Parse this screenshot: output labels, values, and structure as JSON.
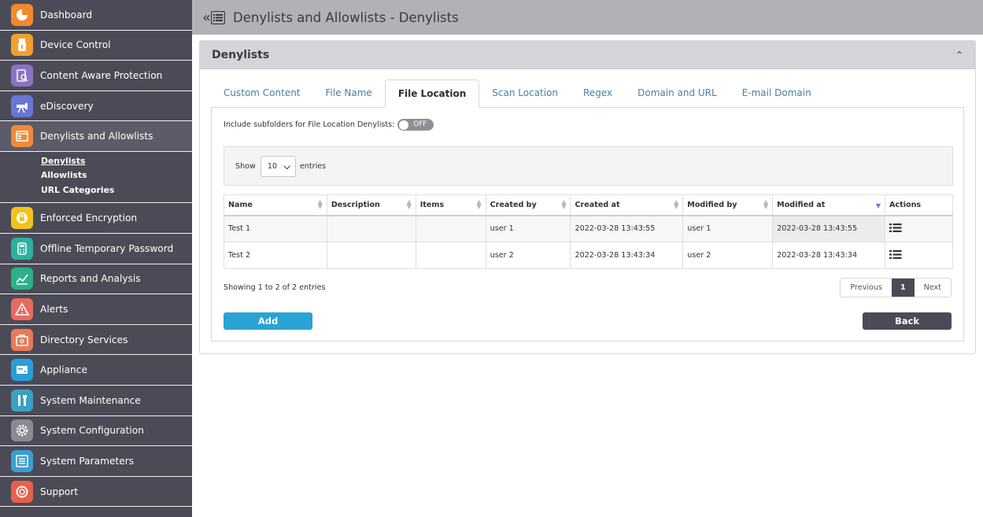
{
  "sidebar": {
    "items": [
      {
        "label": "Dashboard",
        "icon": "dashboard-icon",
        "color": "#f08a2a"
      },
      {
        "label": "Device Control",
        "icon": "usb-icon",
        "color": "#f0a030"
      },
      {
        "label": "Content Aware Protection",
        "icon": "document-search-icon",
        "color": "#8a72c4"
      },
      {
        "label": "eDiscovery",
        "icon": "telescope-icon",
        "color": "#6a76d6"
      },
      {
        "label": "Denylists and Allowlists",
        "icon": "list-window-icon",
        "color": "#f08a3a"
      },
      {
        "label": "Enforced Encryption",
        "icon": "lock-icon",
        "color": "#f2c21e"
      },
      {
        "label": "Offline Temporary Password",
        "icon": "keypad-icon",
        "color": "#2cb0a0"
      },
      {
        "label": "Reports and Analysis",
        "icon": "chart-icon",
        "color": "#2cb08a"
      },
      {
        "label": "Alerts",
        "icon": "warning-icon",
        "color": "#e86a60"
      },
      {
        "label": "Directory Services",
        "icon": "directory-icon",
        "color": "#e87a5a"
      },
      {
        "label": "Appliance",
        "icon": "server-icon",
        "color": "#2a9ed8"
      },
      {
        "label": "System Maintenance",
        "icon": "tools-icon",
        "color": "#3aa0c4"
      },
      {
        "label": "System Configuration",
        "icon": "gear-icon",
        "color": "#8a8a94"
      },
      {
        "label": "System Parameters",
        "icon": "parameters-icon",
        "color": "#3a9ed0"
      },
      {
        "label": "Support",
        "icon": "lifebuoy-icon",
        "color": "#e8604a"
      }
    ],
    "subnav": [
      {
        "label": "Denylists"
      },
      {
        "label": "Allowlists"
      },
      {
        "label": "URL Categories"
      }
    ]
  },
  "header": {
    "collapse_glyph": "«",
    "title": "Denylists and Allowlists - Denylists"
  },
  "panel": {
    "title": "Denylists",
    "collapse_glyph": "⌃"
  },
  "tabs": [
    {
      "label": "Custom Content"
    },
    {
      "label": "File Name"
    },
    {
      "label": "File Location"
    },
    {
      "label": "Scan Location"
    },
    {
      "label": "Regex"
    },
    {
      "label": "Domain and URL"
    },
    {
      "label": "E-mail Domain"
    }
  ],
  "subfolder": {
    "label": "Include subfolders for File Location Denylists:",
    "toggle_text": "OFF"
  },
  "entries": {
    "show_label": "Show",
    "page_size": "10",
    "entries_label": "entries"
  },
  "table": {
    "columns": [
      "Name",
      "Description",
      "Items",
      "Created by",
      "Created at",
      "Modified by",
      "Modified at",
      "Actions"
    ],
    "rows": [
      {
        "name": "Test 1",
        "description": "",
        "items": "",
        "created_by": "user 1",
        "created_at": "2022-03-28 13:43:55",
        "modified_by": "user 1",
        "modified_at": "2022-03-28 13:43:55"
      },
      {
        "name": "Test 2",
        "description": "",
        "items": "",
        "created_by": "user 2",
        "created_at": "2022-03-28 13:43:34",
        "modified_by": "user 2",
        "modified_at": "2022-03-28 13:43:34"
      }
    ]
  },
  "footer": {
    "showing": "Showing 1 to 2 of 2 entries",
    "previous": "Previous",
    "page": "1",
    "next": "Next",
    "add": "Add",
    "back": "Back"
  }
}
